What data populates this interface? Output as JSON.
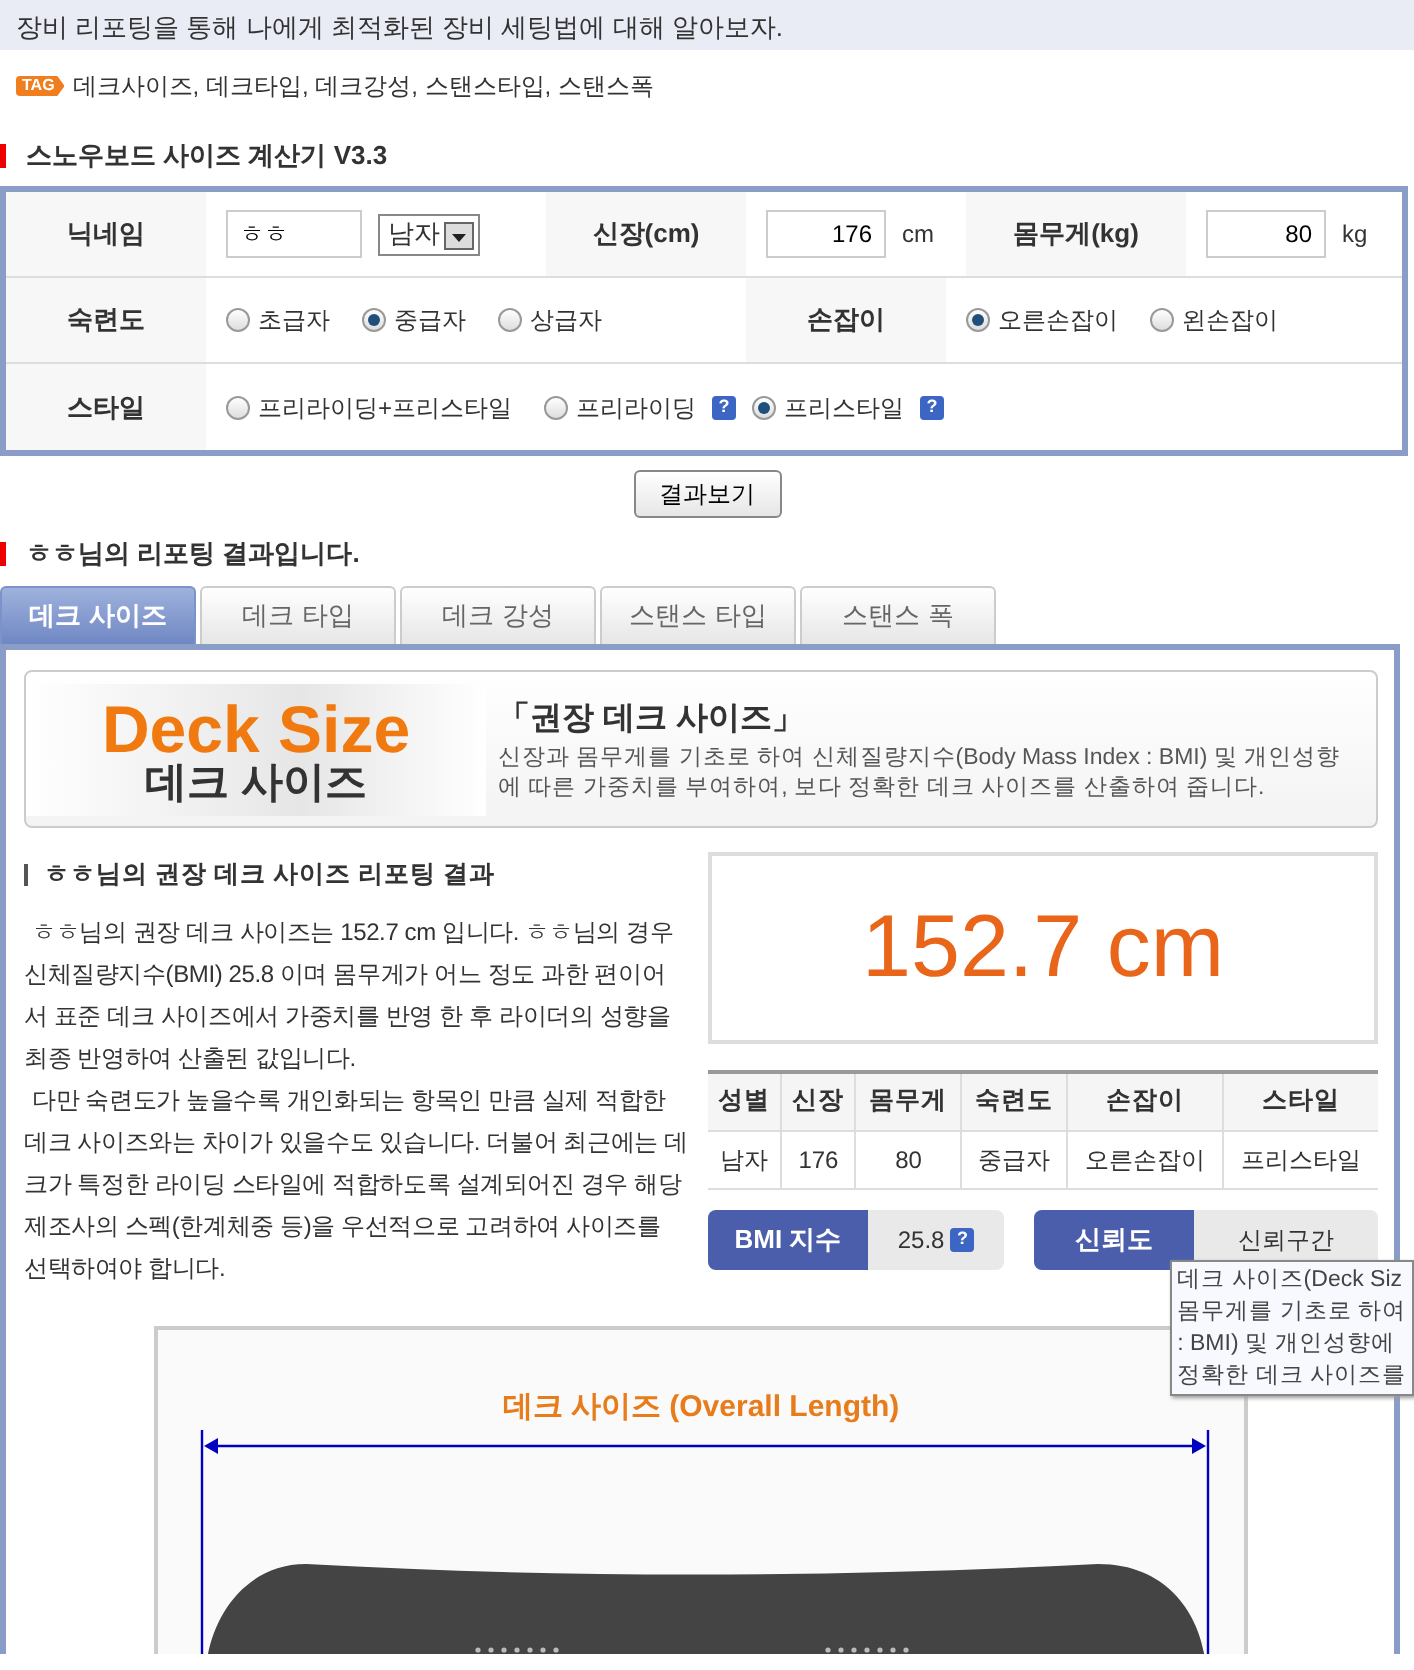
{
  "header": {
    "title": "장비 리포팅을 통해 나에게 최적화된 장비 세팅법에 대해 알아보자.",
    "tag_badge": "TAG",
    "tags": "데크사이즈, 데크타입, 데크강성, 스탠스타입, 스탠스폭"
  },
  "calculator": {
    "title": "스노우보드 사이즈 계산기 V3.3",
    "nickname": {
      "label": "닉네임",
      "value": "ㅎㅎ"
    },
    "gender": {
      "value": "남자"
    },
    "height": {
      "label": "신장(cm)",
      "value": "176",
      "unit": "cm"
    },
    "weight": {
      "label": "몸무게(kg)",
      "value": "80",
      "unit": "kg"
    },
    "skill": {
      "label": "숙련도",
      "options": [
        {
          "label": "초급자",
          "selected": false
        },
        {
          "label": "중급자",
          "selected": true
        },
        {
          "label": "상급자",
          "selected": false
        }
      ]
    },
    "hand": {
      "label": "손잡이",
      "options": [
        {
          "label": "오른손잡이",
          "selected": true
        },
        {
          "label": "왼손잡이",
          "selected": false
        }
      ]
    },
    "style": {
      "label": "스타일",
      "options": [
        {
          "label": "프리라이딩+프리스타일",
          "selected": false
        },
        {
          "label": "프리라이딩",
          "selected": false,
          "help": "?"
        },
        {
          "label": "프리스타일",
          "selected": true,
          "help": "?"
        }
      ]
    },
    "submit_button": "결과보기"
  },
  "result": {
    "title": "ㅎㅎ님의 리포팅 결과입니다.",
    "tabs": [
      {
        "label": "데크 사이즈",
        "selected": true
      },
      {
        "label": "데크 타입",
        "selected": false
      },
      {
        "label": "데크 강성",
        "selected": false
      },
      {
        "label": "스탠스 타입",
        "selected": false
      },
      {
        "label": "스탠스 폭",
        "selected": false
      }
    ],
    "banner": {
      "title_en": "Deck Size",
      "title_ko": "데크 사이즈",
      "heading": "「권장 데크 사이즈」",
      "description": "신장과 몸무게를 기초로 하여 신체질량지수(Body Mass Index : BMI) 및 개인성향에 따른 가중치를 부여하여, 보다 정확한 데크 사이즈를 산출하여 줍니다."
    },
    "subtitle": "ㅎㅎ님의 권장 데크 사이즈 리포팅 결과",
    "paragraphs": [
      "ㅎㅎ님의 권장 데크 사이즈는 152.7 cm 입니다. ㅎㅎ님의 경우 신체질량지수(BMI) 25.8 이며 몸무게가 어느 정도 과한 편이어서 표준 데크 사이즈에서 가중치를 반영 한 후 라이더의 성향을 최종 반영하여 산출된 값입니다.",
      "다만 숙련도가 높을수록 개인화되는 항목인 만큼 실제 적합한 데크 사이즈와는 차이가 있을수도 있습니다. 더불어 최근에는 데크가 특정한 라이딩 스타일에 적합하도록 설계되어진 경우 해당 제조사의 스펙(한계체중 등)을 우선적으로 고려하여 사이즈를 선택하여야 합니다."
    ],
    "size_value": "152.7 cm",
    "summary_table": {
      "columns": [
        "성별",
        "신장",
        "몸무게",
        "숙련도",
        "손잡이",
        "스타일"
      ],
      "rows": [
        [
          "남자",
          "176",
          "80",
          "중급자",
          "오른손잡이",
          "프리스타일"
        ]
      ]
    },
    "bmi": {
      "label": "BMI 지수",
      "value": "25.8",
      "help": "?"
    },
    "reliability": {
      "label": "신뢰도",
      "value": "신뢰구간"
    },
    "diagram": {
      "label": "데크 사이즈 (Overall Length)"
    }
  },
  "tooltip": {
    "lines": [
      "데크 사이즈(Deck Siz",
      "몸무게를 기초로 하여",
      ": BMI) 및 개인성향에",
      "정확한 데크 사이즈를"
    ]
  }
}
